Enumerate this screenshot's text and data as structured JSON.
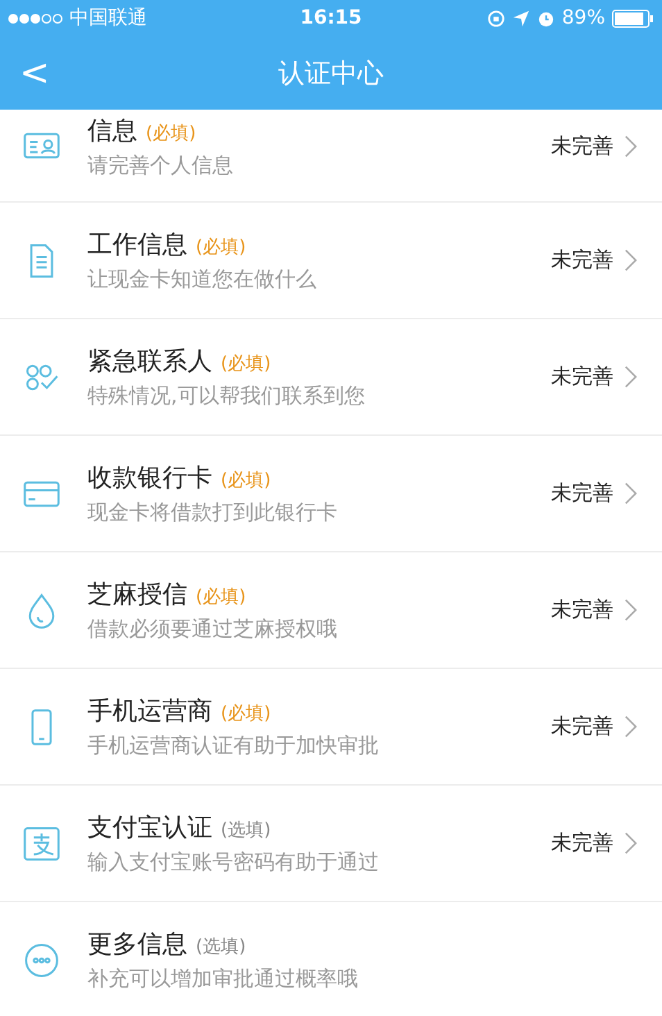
{
  "status_bar": {
    "carrier": "中国联通",
    "time": "16:15",
    "battery": "89%"
  },
  "nav": {
    "back": "<",
    "title": "认证中心"
  },
  "items": [
    {
      "kind": "id",
      "title": "信息",
      "tag": "(必填)",
      "required": true,
      "subtitle": "请完善个人信息",
      "status": "未完善"
    },
    {
      "kind": "doc",
      "title": "工作信息",
      "tag": "(必填)",
      "required": true,
      "subtitle": "让现金卡知道您在做什么",
      "status": "未完善"
    },
    {
      "kind": "contacts",
      "title": "紧急联系人",
      "tag": "(必填)",
      "required": true,
      "subtitle": "特殊情况,可以帮我们联系到您",
      "status": "未完善"
    },
    {
      "kind": "card",
      "title": "收款银行卡",
      "tag": "(必填)",
      "required": true,
      "subtitle": "现金卡将借款打到此银行卡",
      "status": "未完善"
    },
    {
      "kind": "drop",
      "title": "芝麻授信",
      "tag": "(必填)",
      "required": true,
      "subtitle": "借款必须要通过芝麻授权哦",
      "status": "未完善"
    },
    {
      "kind": "phone",
      "title": "手机运营商",
      "tag": "(必填)",
      "required": true,
      "subtitle": "手机运营商认证有助于加快审批",
      "status": "未完善"
    },
    {
      "kind": "alipay",
      "title": "支付宝认证",
      "tag": "(选填)",
      "required": false,
      "subtitle": "输入支付宝账号密码有助于通过",
      "status": "未完善"
    },
    {
      "kind": "more",
      "title": "更多信息",
      "tag": "(选填)",
      "required": false,
      "subtitle": "补充可以增加审批通过概率哦"
    }
  ]
}
